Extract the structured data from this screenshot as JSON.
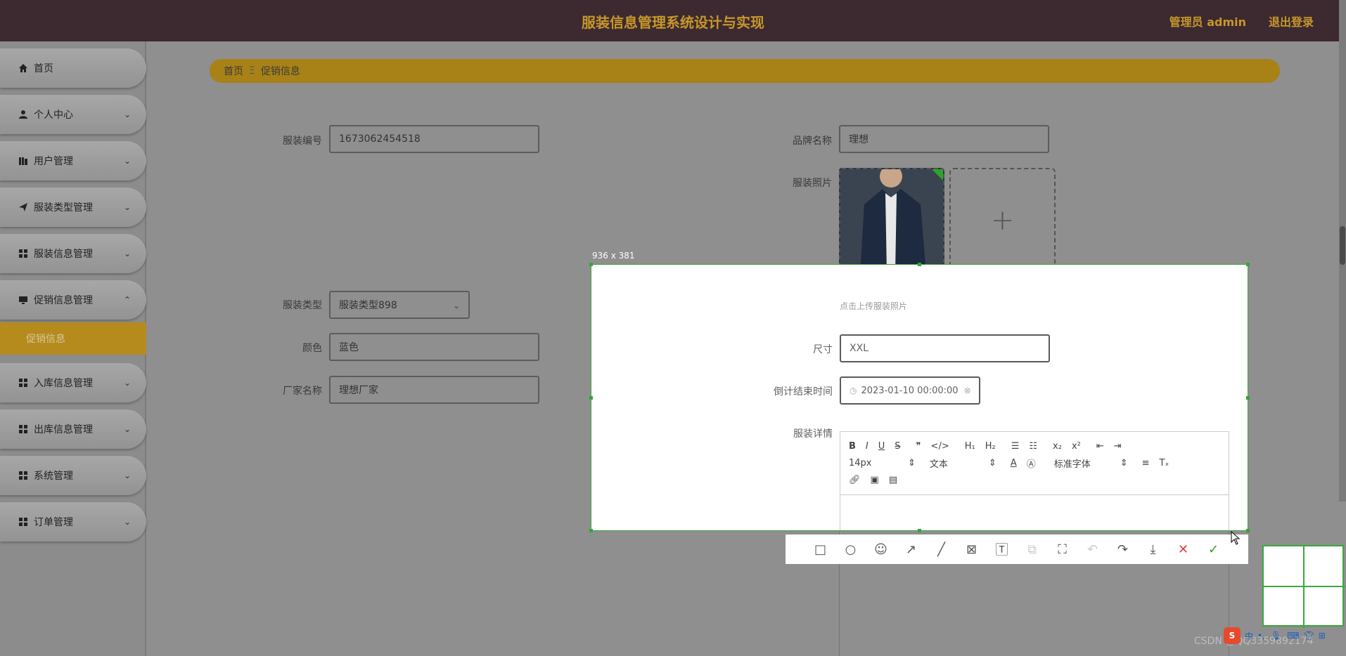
{
  "header": {
    "title": "服装信息管理系统设计与实现",
    "admin_label": "管理员 admin",
    "logout_label": "退出登录"
  },
  "sidebar": {
    "items": [
      {
        "label": "首页",
        "icon": "home-icon"
      },
      {
        "label": "个人中心",
        "icon": "user-icon"
      },
      {
        "label": "用户管理",
        "icon": "users-icon"
      },
      {
        "label": "服装类型管理",
        "icon": "send-icon"
      },
      {
        "label": "服装信息管理",
        "icon": "grid-icon"
      },
      {
        "label": "促销信息管理",
        "icon": "monitor-icon"
      },
      {
        "label": "入库信息管理",
        "icon": "grid-icon"
      },
      {
        "label": "出库信息管理",
        "icon": "grid-icon"
      },
      {
        "label": "系统管理",
        "icon": "grid-icon"
      },
      {
        "label": "订单管理",
        "icon": "grid-icon"
      }
    ],
    "active_sub": "促销信息"
  },
  "breadcrumb": {
    "home": "首页",
    "separator": "Ξ",
    "current": "促销信息"
  },
  "form": {
    "code_label": "服装编号",
    "code_value": "1673062454518",
    "brand_label": "品牌名称",
    "brand_value": "理想",
    "photo_label": "服装照片",
    "type_label": "服装类型",
    "type_value": "服装类型898",
    "color_label": "颜色",
    "color_value": "蓝色",
    "maker_label": "厂家名称",
    "maker_value": "理想厂家",
    "upload_tip": "点击上传服装照片",
    "size_label": "尺寸",
    "size_value": "XXL",
    "countdown_label": "倒计结束时间",
    "countdown_value": "2023-01-10 00:00:00",
    "detail_label": "服装详情"
  },
  "editor": {
    "font_size": "14px",
    "text_type": "文本",
    "font_family": "标准字体"
  },
  "capture": {
    "size_text": "936 x 381"
  },
  "watermark": "CSDN @QQ3359892174",
  "ime_label": "中",
  "colors": {
    "header_bg": "#3c2a30",
    "accent": "#c7972a",
    "active_menu": "#b58b1e",
    "capture_border": "#3aa83a"
  }
}
